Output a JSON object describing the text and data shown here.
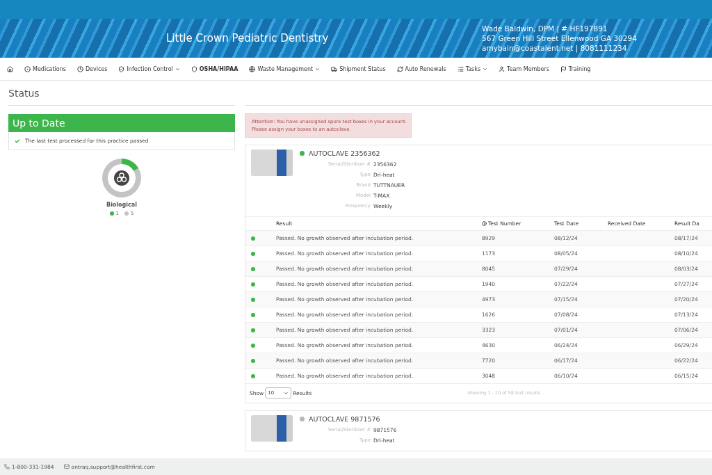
{
  "header": {
    "practice": "Little Crown Pediatric Dentistry",
    "contact_lines": [
      "Wade Baldwin, DPM | # HF197891",
      "567 Green Hill Street Ellenwood GA 30294",
      "amybain@coastalent.net | 8081111234"
    ]
  },
  "nav": [
    {
      "dropdown": false
    },
    {
      "label": "Medications",
      "dropdown": false
    },
    {
      "label": "Devices",
      "dropdown": false
    },
    {
      "label": "Infection Control",
      "dropdown": true
    },
    {
      "label": "OSHA/HIPAA",
      "dropdown": false
    },
    {
      "label": "Waste Management",
      "dropdown": true
    },
    {
      "label": "Shipment Status",
      "dropdown": false
    },
    {
      "label": "Auto Renewals",
      "dropdown": false
    },
    {
      "label": "Tasks",
      "dropdown": true
    },
    {
      "label": "Team Members",
      "dropdown": false
    },
    {
      "label": "Training",
      "dropdown": false
    }
  ],
  "page_title": "Status",
  "status": {
    "heading": "Up to Date",
    "message": "The last test processed for this practice passed"
  },
  "summary": {
    "chart_data": {
      "type": "donut",
      "title": "Biological",
      "categories": [
        "1",
        "5"
      ],
      "values": [
        1,
        5
      ],
      "colors": [
        "#3cb54a",
        "#c4c4c4"
      ]
    }
  },
  "alert": {
    "lines": [
      "Attention: You have unassigned spore test boxes in your account.",
      "Please assign your boxes to an autoclave."
    ]
  },
  "autoclaves": [
    {
      "name": "AUTOCLAVE 2356362",
      "color": "#3cb54a",
      "fields": [
        {
          "label": "Serial/Sterilizer #",
          "value": "2356362"
        },
        {
          "label": "Type",
          "value": "Dri-heat"
        },
        {
          "label": "Brand",
          "value": "TUTTNAUER"
        },
        {
          "label": "Model",
          "value": "T-MAX"
        },
        {
          "label": "Frequency",
          "value": "Weekly"
        }
      ],
      "table": {
        "columns": [
          "Result",
          "Test Number",
          "Test Date",
          "Received Date",
          "Result Da"
        ],
        "rows": [
          {
            "color": "#3cb54a",
            "cells": [
              "Passed. No growth observed after incubation period.",
              "8929",
              "08/12/24",
              "",
              "08/17/24"
            ]
          },
          {
            "color": "#3cb54a",
            "cells": [
              "Passed. No growth observed after incubation period.",
              "1173",
              "08/05/24",
              "",
              "08/10/24"
            ]
          },
          {
            "color": "#3cb54a",
            "cells": [
              "Passed. No growth observed after incubation period.",
              "8045",
              "07/29/24",
              "",
              "08/03/24"
            ]
          },
          {
            "color": "#3cb54a",
            "cells": [
              "Passed. No growth observed after incubation period.",
              "1940",
              "07/22/24",
              "",
              "07/27/24"
            ]
          },
          {
            "color": "#3cb54a",
            "cells": [
              "Passed. No growth observed after incubation period.",
              "4973",
              "07/15/24",
              "",
              "07/20/24"
            ]
          },
          {
            "color": "#3cb54a",
            "cells": [
              "Passed. No growth observed after incubation period.",
              "1626",
              "07/08/24",
              "",
              "07/13/24"
            ]
          },
          {
            "color": "#3cb54a",
            "cells": [
              "Passed. No growth observed after incubation period.",
              "3323",
              "07/01/24",
              "",
              "07/06/24"
            ]
          },
          {
            "color": "#3cb54a",
            "cells": [
              "Passed. No growth observed after incubation period.",
              "4630",
              "06/24/24",
              "",
              "06/29/24"
            ]
          },
          {
            "color": "#3cb54a",
            "cells": [
              "Passed. No growth observed after incubation period.",
              "7720",
              "06/17/24",
              "",
              "06/22/24"
            ]
          },
          {
            "color": "#3cb54a",
            "cells": [
              "Passed. No growth observed after incubation period.",
              "3048",
              "06/10/24",
              "",
              "06/15/24"
            ]
          }
        ],
        "show_label": "Show",
        "page_size": "10",
        "results_label": "Results",
        "showing": "showing 1 - 10 of 58 test results"
      }
    },
    {
      "name": "AUTOCLAVE 9871576",
      "color": "#b8b8b8",
      "fields": [
        {
          "label": "Serial/Sterilizer #",
          "value": "9871576"
        },
        {
          "label": "Type",
          "value": "Dri-heat"
        }
      ]
    }
  ],
  "footer": {
    "phone": "1-800-331-1984",
    "email": "ontraq.support@healthfirst.com"
  }
}
